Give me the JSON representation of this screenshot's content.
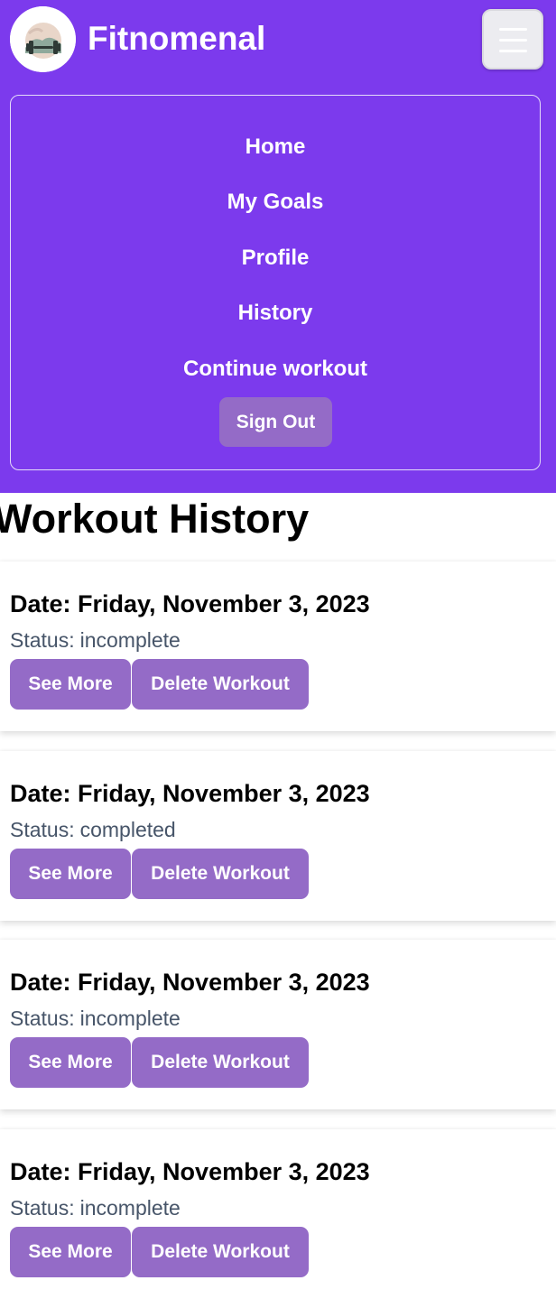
{
  "app": {
    "name": "Fitnomenal",
    "logo_icon": "dumbbell-landscape-logo"
  },
  "colors": {
    "navbar_bg": "#7c3aed",
    "button_bg": "#946bc7",
    "status_text": "#475569"
  },
  "nav": {
    "toggle_icon": "hamburger-menu-icon",
    "links": [
      {
        "label": "Home"
      },
      {
        "label": "My Goals"
      },
      {
        "label": "Profile"
      },
      {
        "label": "History"
      },
      {
        "label": "Continue workout"
      }
    ],
    "signout_label": "Sign Out"
  },
  "page": {
    "title": "Workout History"
  },
  "workouts": [
    {
      "date_label": "Date:",
      "date": "Friday, November 3, 2023",
      "status_label": "Status:",
      "status": "incomplete",
      "see_more_label": "See More",
      "delete_label": "Delete Workout"
    },
    {
      "date_label": "Date:",
      "date": "Friday, November 3, 2023",
      "status_label": "Status:",
      "status": "completed",
      "see_more_label": "See More",
      "delete_label": "Delete Workout"
    },
    {
      "date_label": "Date:",
      "date": "Friday, November 3, 2023",
      "status_label": "Status:",
      "status": "incomplete",
      "see_more_label": "See More",
      "delete_label": "Delete Workout"
    },
    {
      "date_label": "Date:",
      "date": "Friday, November 3, 2023",
      "status_label": "Status:",
      "status": "incomplete",
      "see_more_label": "See More",
      "delete_label": "Delete Workout"
    }
  ]
}
